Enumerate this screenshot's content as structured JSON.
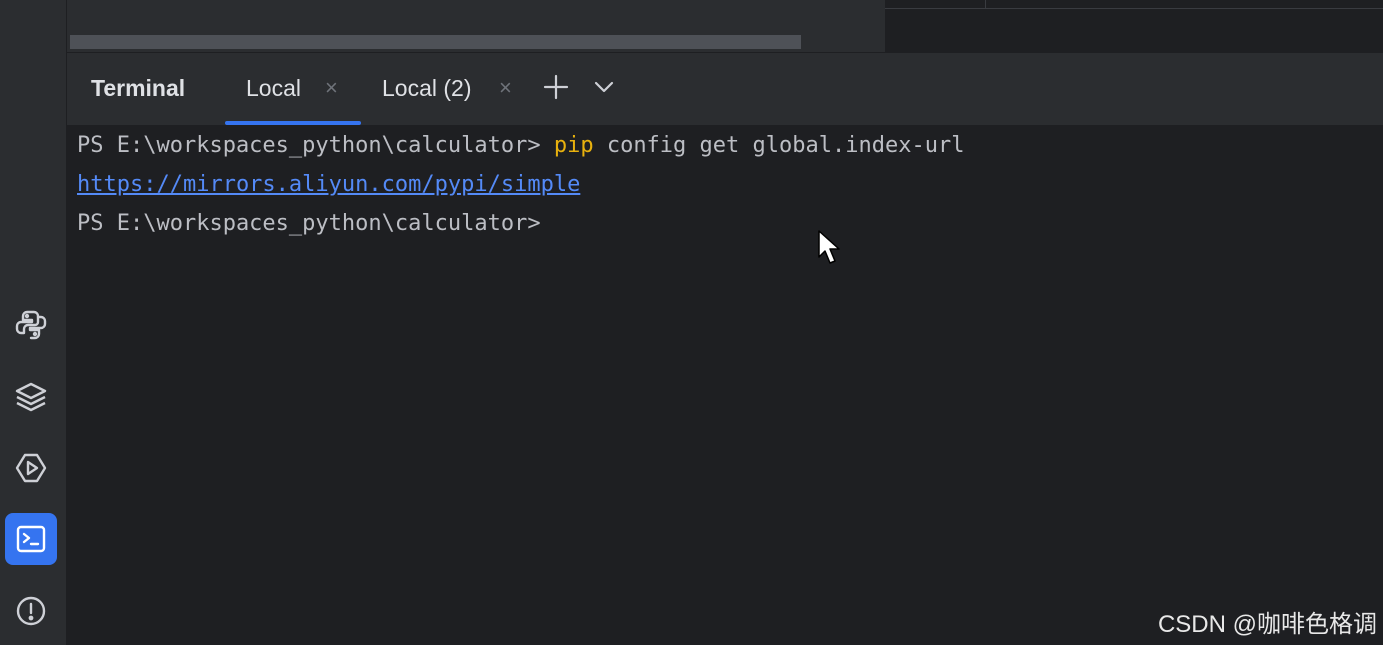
{
  "toolwindow": {
    "title": "Terminal",
    "tabs": [
      {
        "label": "Local",
        "active": true,
        "close": "×"
      },
      {
        "label": "Local (2)",
        "active": false,
        "close": "×"
      }
    ],
    "add_icon": "plus-icon",
    "more_icon": "chevron-down-icon"
  },
  "sidebar": {
    "items": [
      {
        "icon": "python-icon"
      },
      {
        "icon": "layers-icon"
      },
      {
        "icon": "run-services-icon"
      },
      {
        "icon": "terminal-icon",
        "active": true
      },
      {
        "icon": "problems-icon"
      }
    ]
  },
  "terminal": {
    "lines": [
      {
        "prompt": "PS E:\\workspaces_python\\calculator> ",
        "cmd": "pip",
        "args": " config get global.index-url"
      },
      {
        "link": "https://mirrors.aliyun.com/pypi/simple"
      },
      {
        "prompt": "PS E:\\workspaces_python\\calculator>"
      }
    ]
  },
  "watermark": "CSDN @咖啡色格调",
  "colors": {
    "accent": "#3574f0",
    "command": "#e8b10e",
    "link": "#548af7",
    "text": "#bcbec4",
    "panel": "#2b2d30",
    "background": "#1e1f22"
  }
}
